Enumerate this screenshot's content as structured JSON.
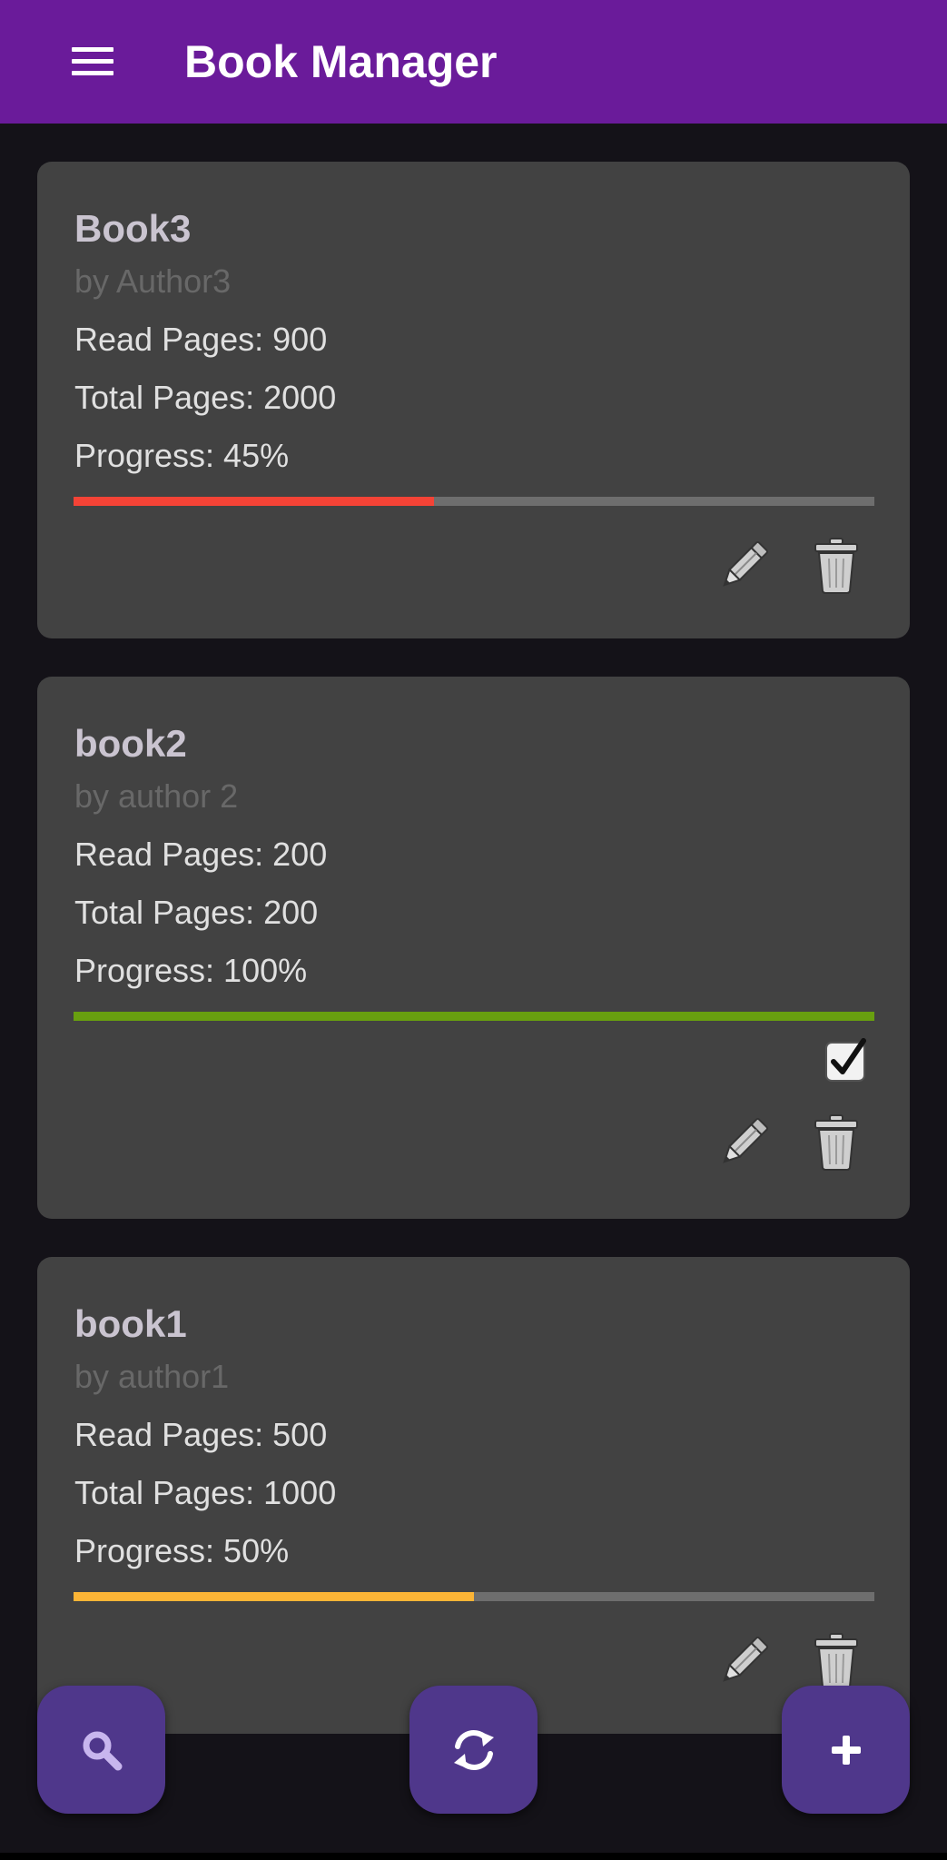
{
  "app_bar": {
    "title": "Book Manager",
    "menu_icon": "hamburger-menu-icon",
    "color": "#6a1b9a"
  },
  "books": [
    {
      "title": "Book3",
      "author": "by Author3",
      "read_pages": "Read Pages: 900",
      "total_pages": "Total Pages: 2000",
      "progress_text": "Progress: 45%",
      "progress": 0.45,
      "progress_color": "#f44336",
      "completed": false
    },
    {
      "title": "book2",
      "author": "by author 2",
      "read_pages": "Read Pages: 200",
      "total_pages": "Total Pages: 200",
      "progress_text": "Progress: 100%",
      "progress": 1.0,
      "progress_color": "#689f0f",
      "completed": true
    },
    {
      "title": "book1",
      "author": "by author1",
      "read_pages": "Read Pages: 500",
      "total_pages": "Total Pages: 1000",
      "progress_text": "Progress: 50%",
      "progress": 0.5,
      "progress_color": "#fbb436",
      "completed": false
    }
  ],
  "card_actions": {
    "edit_icon": "pencil-icon",
    "delete_icon": "trash-icon",
    "completed_icon": "checkbox-checked-icon"
  },
  "fabs": {
    "search_icon": "search-icon",
    "sync_icon": "sync-icon",
    "add_icon": "plus-icon",
    "color": "#4f378b"
  }
}
